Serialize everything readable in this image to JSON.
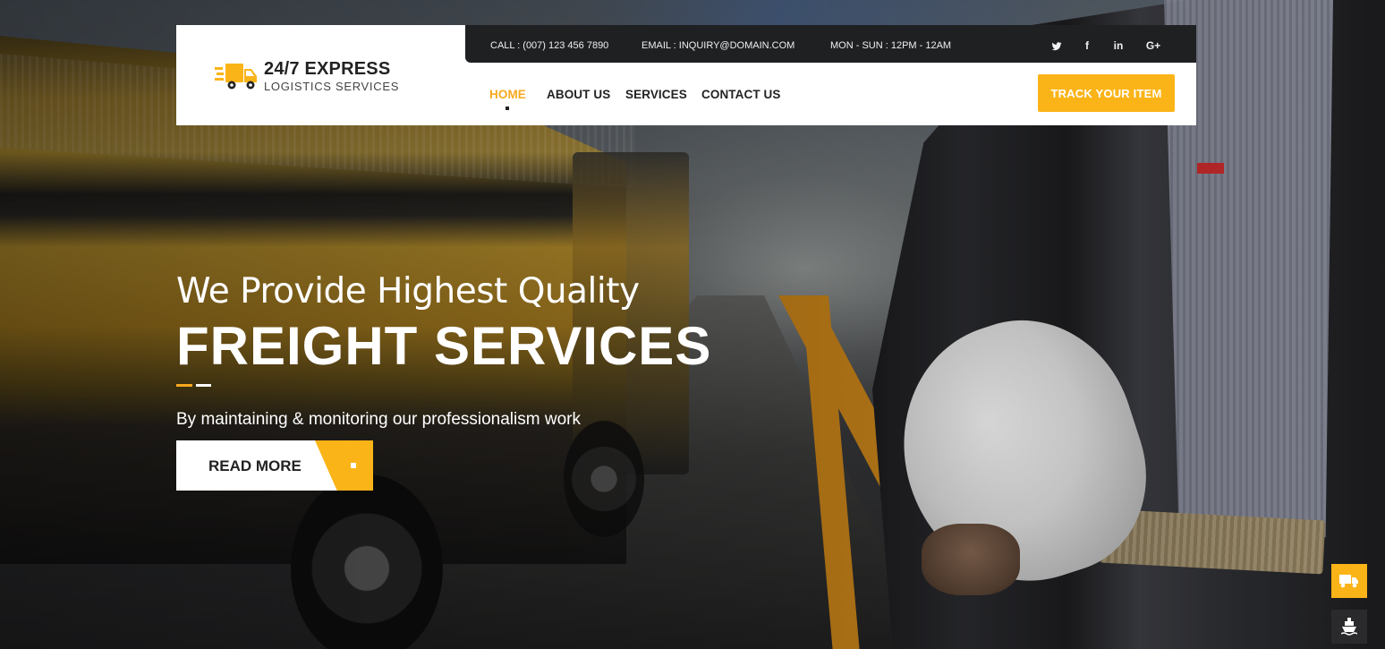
{
  "brand": {
    "name": "24/7 EXPRESS",
    "tagline": "LOGISTICS SERVICES",
    "accent_color": "#fbb418",
    "logo_icon": "delivery-truck-icon"
  },
  "topbar": {
    "call": "CALL : (007) 123 456 7890",
    "email": "EMAIL :  INQUIRY@DOMAIN.COM",
    "hours": "MON - SUN : 12PM - 12AM",
    "social": {
      "twitter_icon": "twitter-icon",
      "facebook_label": "f",
      "linkedin_label": "in",
      "googleplus_label": "G+"
    }
  },
  "nav": {
    "items": [
      {
        "label": "HOME",
        "active": true
      },
      {
        "label": "ABOUT US",
        "active": false
      },
      {
        "label": "SERVICES",
        "active": false
      },
      {
        "label": "CONTACT US",
        "active": false
      }
    ],
    "cta_label": "TRACK YOUR ITEM"
  },
  "hero": {
    "line1": "We Provide Highest Quality",
    "line2": "FREIGHT SERVICES",
    "subtitle": "By maintaining & monitoring our professionalism work",
    "button_label": "READ MORE"
  },
  "floating": {
    "truck_icon": "delivery-truck-icon",
    "ship_icon": "ship-icon"
  },
  "colors": {
    "accent": "#fbb418",
    "active_nav": "#f7a91e",
    "topbar_bg": "#1f2022",
    "text_dark": "#222222"
  }
}
